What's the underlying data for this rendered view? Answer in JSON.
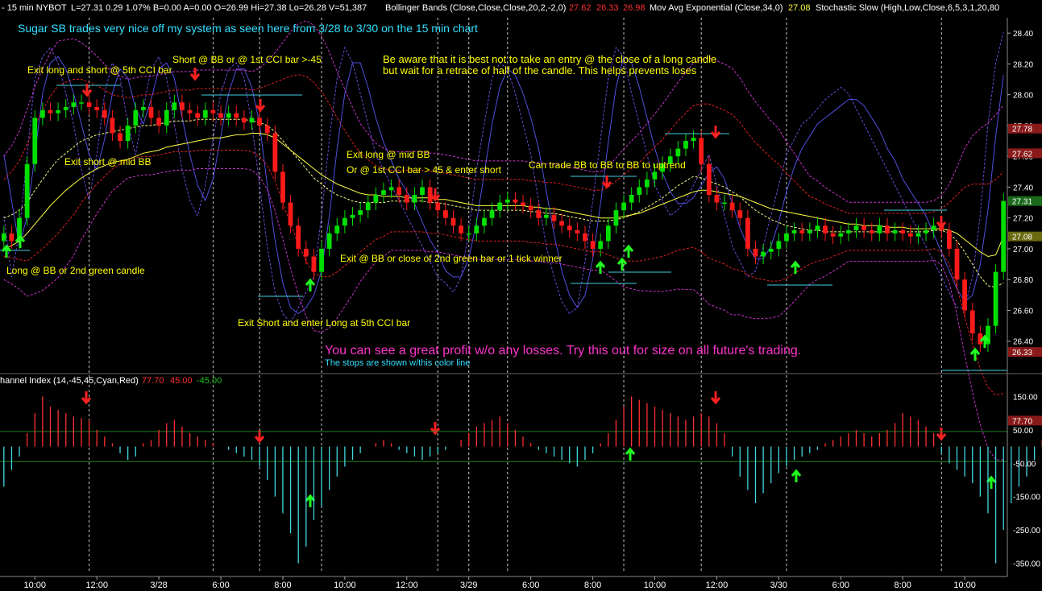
{
  "header": {
    "symbol_label": "- 15 min  NYBOT",
    "stats": "L=27.31  0.29  1.07%  B=0.00  A=0.00  O=26.99  Hi=27.38  Lo=26.28  V=51,387",
    "bb_label": "Bollinger Bands (Close,Close,Close,20,2,-2,0)",
    "bb_values": [
      "27.62",
      "26.33",
      "26.98"
    ],
    "ema_label": "Mov Avg Exponential (Close,34,0)",
    "ema_value": "27.08",
    "stoch_label": "Stochastic Slow (High,Low,Close,6,5,3,1,20,80"
  },
  "cci_header": {
    "label": "hannel Index (14,-45,45,Cyan,Red)",
    "value": "77.70",
    "upper": "45.00",
    "lower": "-45.00"
  },
  "annotations": {
    "title": "Sugar SB trades very nice off my system as seen here from 3/28 to 3/30 on the 15 min chart",
    "exit_long_short": "Exit long and short @ 5th CCI bar",
    "short_bb": "Short @ BB or @ 1st CCI bar >-45",
    "be_aware_1": "Be aware that it is best not to take an entry @ the close of a long candle",
    "be_aware_2": "but wait for a retrace of half of the candle. This helps prevents loses",
    "exit_short_mid": "Exit short @ mid BB",
    "exit_long_mid_1": "Exit long @ mid BB",
    "exit_long_mid_2": "Or @ 1st CCI bar > 45 & enter short",
    "can_trade": "Can trade BB to BB to BB to uptrend",
    "long_bb": "Long @ BB or 2nd green candle",
    "exit_bb_close": "Exit @ BB or close of 2nd green bar or 1 tick winner",
    "exit_short_enter_long": "Exit Short and enter Long at 5th CCI bar",
    "great_profit": "You can see a great profit w/o any losses. Try this out for size on all future's trading.",
    "stops": "The stops are shown w/this color line"
  },
  "colors": {
    "background": "#000000",
    "up_candle": "#00e000",
    "down_candle": "#ff1a1a",
    "bb_band": "#e02020",
    "ema": "#ffff40",
    "stoch": "#cc33cc",
    "annotation_yellow": "#ffff00",
    "title_cyan": "#33e0ff",
    "profit_magenta": "#ff33cc",
    "stop_line": "#40d0e0",
    "cci_pos": "#ff3030",
    "cci_neg": "#40d8e0"
  },
  "chart_data": [
    {
      "type": "candlestick",
      "title": "",
      "ylim": [
        26.2,
        28.5
      ],
      "yticks": [
        "28.40",
        "28.20",
        "28.00",
        "27.80",
        "27.60",
        "27.40",
        "27.20",
        "27.00",
        "26.80",
        "26.60",
        "26.40"
      ],
      "ytick_values": [
        28.4,
        28.2,
        28.0,
        27.8,
        27.6,
        27.4,
        27.2,
        27.0,
        26.8,
        26.6,
        26.4
      ],
      "price_tags": [
        {
          "text": "27.78",
          "value": 27.78,
          "color": "#8a1a1a"
        },
        {
          "text": "27.62",
          "value": 27.62,
          "color": "#8a1a1a"
        },
        {
          "text": "27.31",
          "value": 27.31,
          "color": "#1a6a1a"
        },
        {
          "text": "27.08",
          "value": 27.08,
          "color": "#6a6a10"
        },
        {
          "text": "26.33",
          "value": 26.33,
          "color": "#8a1a1a"
        }
      ],
      "x_labels": [
        "10:00",
        "12:00",
        "3/28",
        "6:00",
        "8:00",
        "10:00",
        "12:00",
        "3/29",
        "6:00",
        "8:00",
        "10:00",
        "12:00",
        "3/30",
        "6:00",
        "8:00",
        "10:00"
      ],
      "x_label_bars": [
        4,
        12,
        20,
        28,
        36,
        44,
        52,
        60,
        68,
        76,
        84,
        92,
        100,
        108,
        116,
        124
      ],
      "bar_count": 130,
      "closes": [
        27.1,
        27.05,
        27.2,
        27.55,
        27.85,
        27.9,
        27.88,
        27.9,
        27.92,
        27.95,
        27.95,
        27.92,
        27.9,
        27.85,
        27.75,
        27.7,
        27.8,
        27.9,
        27.92,
        27.85,
        27.8,
        27.9,
        27.95,
        27.9,
        27.88,
        27.85,
        27.9,
        27.88,
        27.85,
        27.88,
        27.85,
        27.82,
        27.85,
        27.8,
        27.75,
        27.5,
        27.3,
        27.15,
        27.0,
        26.95,
        26.85,
        27.0,
        27.1,
        27.15,
        27.2,
        27.22,
        27.25,
        27.3,
        27.35,
        27.38,
        27.4,
        27.35,
        27.3,
        27.35,
        27.4,
        27.3,
        27.25,
        27.2,
        27.15,
        27.1,
        27.1,
        27.15,
        27.2,
        27.25,
        27.3,
        27.32,
        27.3,
        27.28,
        27.25,
        27.2,
        27.22,
        27.18,
        27.15,
        27.12,
        27.1,
        27.05,
        27.0,
        27.05,
        27.15,
        27.25,
        27.3,
        27.35,
        27.4,
        27.45,
        27.5,
        27.55,
        27.6,
        27.65,
        27.7,
        27.72,
        27.55,
        27.35,
        27.3,
        27.3,
        27.25,
        27.2,
        27.0,
        26.95,
        26.98,
        27.0,
        27.05,
        27.1,
        27.12,
        27.1,
        27.12,
        27.15,
        27.1,
        27.08,
        27.1,
        27.12,
        27.15,
        27.12,
        27.1,
        27.15,
        27.1,
        27.12,
        27.1,
        27.08,
        27.1,
        27.12,
        27.15,
        27.12,
        27.0,
        26.8,
        26.6,
        26.45,
        26.38,
        26.5,
        26.85,
        27.31
      ],
      "bb_mid": [
        27.2,
        27.22,
        27.25,
        27.3,
        27.38,
        27.45,
        27.52,
        27.58,
        27.62,
        27.66,
        27.7,
        27.72,
        27.74,
        27.75,
        27.76,
        27.77,
        27.78,
        27.79,
        27.8,
        27.8,
        27.81,
        27.82,
        27.83,
        27.83,
        27.83,
        27.84,
        27.84,
        27.84,
        27.84,
        27.84,
        27.84,
        27.84,
        27.83,
        27.82,
        27.8,
        27.76,
        27.7,
        27.64,
        27.58,
        27.52,
        27.46,
        27.42,
        27.38,
        27.35,
        27.33,
        27.31,
        27.3,
        27.3,
        27.3,
        27.3,
        27.31,
        27.31,
        27.31,
        27.31,
        27.31,
        27.3,
        27.3,
        27.29,
        27.28,
        27.27,
        27.26,
        27.25,
        27.25,
        27.25,
        27.25,
        27.25,
        27.25,
        27.25,
        27.24,
        27.24,
        27.23,
        27.23,
        27.22,
        27.21,
        27.2,
        27.19,
        27.18,
        27.18,
        27.18,
        27.19,
        27.2,
        27.22,
        27.24,
        27.27,
        27.3,
        27.33,
        27.37,
        27.41,
        27.44,
        27.47,
        27.46,
        27.44,
        27.42,
        27.4,
        27.37,
        27.34,
        27.29,
        27.25,
        27.22,
        27.19,
        27.17,
        27.15,
        27.14,
        27.13,
        27.12,
        27.12,
        27.11,
        27.11,
        27.11,
        27.11,
        27.11,
        27.11,
        27.11,
        27.11,
        27.11,
        27.11,
        27.11,
        27.11,
        27.11,
        27.11,
        27.12,
        27.12,
        27.1,
        27.05,
        26.98,
        26.9,
        26.82,
        26.76,
        26.75,
        26.78
      ],
      "bb_halfwidth": [
        0.25,
        0.28,
        0.32,
        0.38,
        0.42,
        0.45,
        0.47,
        0.48,
        0.46,
        0.44,
        0.4,
        0.36,
        0.32,
        0.28,
        0.24,
        0.22,
        0.2,
        0.2,
        0.2,
        0.2,
        0.2,
        0.2,
        0.2,
        0.2,
        0.2,
        0.2,
        0.2,
        0.2,
        0.2,
        0.2,
        0.2,
        0.2,
        0.2,
        0.22,
        0.26,
        0.32,
        0.4,
        0.48,
        0.55,
        0.6,
        0.62,
        0.6,
        0.56,
        0.5,
        0.44,
        0.38,
        0.32,
        0.28,
        0.24,
        0.22,
        0.2,
        0.2,
        0.2,
        0.2,
        0.2,
        0.2,
        0.2,
        0.2,
        0.2,
        0.2,
        0.2,
        0.2,
        0.2,
        0.2,
        0.2,
        0.2,
        0.2,
        0.2,
        0.2,
        0.2,
        0.2,
        0.2,
        0.2,
        0.2,
        0.2,
        0.2,
        0.2,
        0.2,
        0.22,
        0.25,
        0.28,
        0.3,
        0.32,
        0.34,
        0.36,
        0.38,
        0.4,
        0.42,
        0.44,
        0.46,
        0.48,
        0.5,
        0.5,
        0.5,
        0.5,
        0.48,
        0.46,
        0.44,
        0.42,
        0.4,
        0.38,
        0.34,
        0.3,
        0.26,
        0.22,
        0.2,
        0.18,
        0.16,
        0.14,
        0.12,
        0.12,
        0.12,
        0.12,
        0.12,
        0.12,
        0.12,
        0.12,
        0.12,
        0.12,
        0.12,
        0.12,
        0.14,
        0.2,
        0.3,
        0.42,
        0.52,
        0.6,
        0.66,
        0.7,
        0.72
      ],
      "ema": [
        27.0,
        27.02,
        27.05,
        27.1,
        27.16,
        27.22,
        27.28,
        27.33,
        27.38,
        27.42,
        27.46,
        27.49,
        27.52,
        27.54,
        27.56,
        27.57,
        27.58,
        27.6,
        27.62,
        27.63,
        27.64,
        27.66,
        27.67,
        27.68,
        27.69,
        27.7,
        27.71,
        27.72,
        27.72,
        27.73,
        27.74,
        27.74,
        27.75,
        27.75,
        27.74,
        27.72,
        27.68,
        27.64,
        27.6,
        27.56,
        27.52,
        27.48,
        27.45,
        27.42,
        27.4,
        27.38,
        27.36,
        27.35,
        27.35,
        27.34,
        27.34,
        27.34,
        27.33,
        27.33,
        27.33,
        27.33,
        27.32,
        27.32,
        27.31,
        27.3,
        27.29,
        27.28,
        27.28,
        27.28,
        27.28,
        27.28,
        27.28,
        27.28,
        27.27,
        27.27,
        27.26,
        27.26,
        27.25,
        27.24,
        27.23,
        27.22,
        27.21,
        27.2,
        27.2,
        27.2,
        27.21,
        27.22,
        27.23,
        27.25,
        27.27,
        27.29,
        27.31,
        27.33,
        27.35,
        27.37,
        27.38,
        27.38,
        27.37,
        27.36,
        27.35,
        27.34,
        27.32,
        27.3,
        27.28,
        27.26,
        27.25,
        27.24,
        27.23,
        27.22,
        27.21,
        27.2,
        27.19,
        27.18,
        27.17,
        27.16,
        27.16,
        27.15,
        27.15,
        27.15,
        27.14,
        27.14,
        27.14,
        27.13,
        27.13,
        27.13,
        27.13,
        27.13,
        27.12,
        27.1,
        27.06,
        27.02,
        26.98,
        26.95,
        26.96,
        27.08
      ],
      "stoch_pct": [
        40,
        20,
        35,
        60,
        85,
        92,
        95,
        90,
        80,
        70,
        55,
        45,
        60,
        80,
        90,
        85,
        70,
        60,
        75,
        88,
        92,
        85,
        70,
        55,
        45,
        40,
        50,
        65,
        80,
        88,
        90,
        85,
        70,
        50,
        30,
        15,
        8,
        5,
        10,
        15,
        20,
        40,
        65,
        85,
        95,
        90,
        80,
        70,
        60,
        55,
        50,
        45,
        40,
        35,
        30,
        25,
        20,
        18,
        15,
        20,
        35,
        55,
        70,
        85,
        90,
        88,
        80,
        70,
        60,
        45,
        30,
        20,
        12,
        8,
        10,
        25,
        45,
        65,
        85,
        95,
        92,
        80,
        70,
        60,
        50,
        45,
        40,
        42,
        45,
        50,
        55,
        60,
        50,
        40,
        30,
        25,
        20,
        22,
        30,
        40,
        50,
        60,
        65,
        70,
        72,
        75,
        78,
        80,
        82,
        80,
        75,
        70,
        65,
        60,
        55,
        50,
        45,
        40,
        35,
        30,
        25,
        20,
        15,
        10,
        10,
        20,
        40,
        70,
        90,
        100
      ],
      "stoch_pct2": [
        60,
        45,
        30,
        40,
        60,
        80,
        90,
        92,
        88,
        80,
        70,
        60,
        55,
        65,
        80,
        88,
        85,
        75,
        70,
        78,
        88,
        90,
        85,
        72,
        60,
        50,
        45,
        52,
        66,
        80,
        88,
        88,
        82,
        70,
        50,
        32,
        18,
        10,
        8,
        10,
        14,
        22,
        40,
        62,
        80,
        90,
        90,
        82,
        72,
        64,
        58,
        52,
        48,
        44,
        38,
        32,
        28,
        22,
        20,
        20,
        26,
        38,
        54,
        70,
        82,
        88,
        86,
        80,
        72,
        62,
        48,
        34,
        22,
        14,
        10,
        14,
        26,
        44,
        64,
        82,
        92,
        90,
        82,
        72,
        62,
        54,
        48,
        44,
        44,
        46,
        50,
        54,
        56,
        52,
        44,
        36,
        30,
        26,
        26,
        30,
        38,
        48,
        56,
        62,
        66,
        70,
        72,
        74,
        76,
        78,
        78,
        76,
        72,
        68,
        62,
        58,
        52,
        48,
        44,
        40,
        34,
        28,
        22,
        16,
        12,
        14,
        24,
        42,
        66,
        86
      ]
    },
    {
      "type": "bar",
      "title": "",
      "ylim": [
        -380,
        180
      ],
      "yticks": [
        "150.00",
        "50.00",
        "-50.00",
        "-150.00",
        "-250.00",
        "-350.00"
      ],
      "ytick_values": [
        150,
        50,
        -50,
        -150,
        -250,
        -350
      ],
      "price_tags": [
        {
          "text": "77.70",
          "value": 77.7,
          "color": "#8a1a1a"
        }
      ],
      "bar_count": 130,
      "values": [
        -120,
        -70,
        -30,
        40,
        100,
        150,
        120,
        110,
        100,
        90,
        85,
        80,
        50,
        30,
        10,
        -20,
        -40,
        -30,
        10,
        20,
        50,
        70,
        80,
        60,
        40,
        30,
        20,
        10,
        0,
        -10,
        -20,
        -30,
        -40,
        -60,
        -100,
        -150,
        -200,
        -260,
        -350,
        -300,
        -220,
        -180,
        -130,
        -90,
        -60,
        -40,
        -20,
        0,
        10,
        20,
        10,
        -10,
        -20,
        -30,
        -40,
        -30,
        -20,
        -10,
        0,
        20,
        40,
        60,
        70,
        80,
        90,
        70,
        50,
        30,
        10,
        -10,
        -20,
        -30,
        -40,
        -50,
        -60,
        -40,
        -20,
        10,
        40,
        80,
        120,
        150,
        140,
        130,
        120,
        110,
        100,
        90,
        80,
        90,
        100,
        90,
        70,
        40,
        -30,
        -90,
        -130,
        -170,
        -140,
        -110,
        -80,
        -60,
        -40,
        -30,
        -20,
        -10,
        10,
        20,
        30,
        40,
        50,
        40,
        30,
        40,
        50,
        70,
        100,
        90,
        80,
        60,
        40,
        -20,
        -50,
        -70,
        -90,
        -110,
        -150,
        -200,
        -350,
        -250,
        -170,
        -120,
        -90,
        -40,
        20
      ]
    }
  ]
}
